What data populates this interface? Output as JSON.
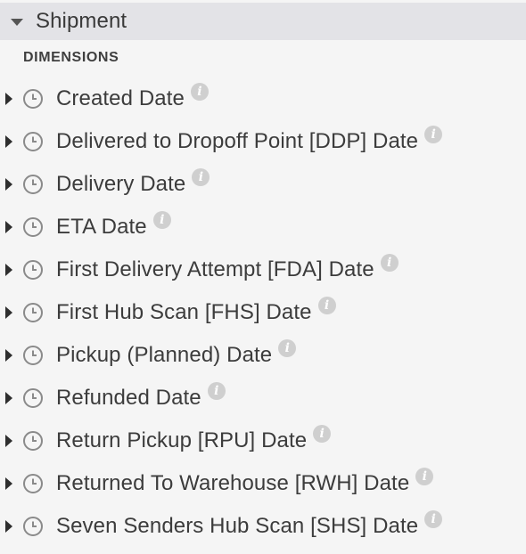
{
  "group": {
    "title": "Shipment",
    "icon": "caret-down-icon"
  },
  "section": {
    "label": "DIMENSIONS"
  },
  "fields": [
    {
      "label": "Created Date",
      "icon": "clock-icon",
      "info_icon": "info-icon"
    },
    {
      "label": "Delivered to Dropoff Point [DDP] Date",
      "icon": "clock-icon",
      "info_icon": "info-icon"
    },
    {
      "label": "Delivery Date",
      "icon": "clock-icon",
      "info_icon": "info-icon"
    },
    {
      "label": "ETA Date",
      "icon": "clock-icon",
      "info_icon": "info-icon"
    },
    {
      "label": "First Delivery Attempt [FDA] Date",
      "icon": "clock-icon",
      "info_icon": "info-icon"
    },
    {
      "label": "First Hub Scan [FHS] Date",
      "icon": "clock-icon",
      "info_icon": "info-icon"
    },
    {
      "label": "Pickup (Planned) Date",
      "icon": "clock-icon",
      "info_icon": "info-icon"
    },
    {
      "label": "Refunded Date",
      "icon": "clock-icon",
      "info_icon": "info-icon"
    },
    {
      "label": "Return Pickup [RPU] Date",
      "icon": "clock-icon",
      "info_icon": "info-icon"
    },
    {
      "label": "Returned To Warehouse [RWH] Date",
      "icon": "clock-icon",
      "info_icon": "info-icon"
    },
    {
      "label": "Seven Senders Hub Scan [SHS] Date",
      "icon": "clock-icon",
      "info_icon": "info-icon"
    }
  ],
  "colors": {
    "background": "#f5f5f5",
    "header_background": "#e3e3e7",
    "text": "#3c3c3c",
    "info_icon": "#cfcfcf"
  }
}
